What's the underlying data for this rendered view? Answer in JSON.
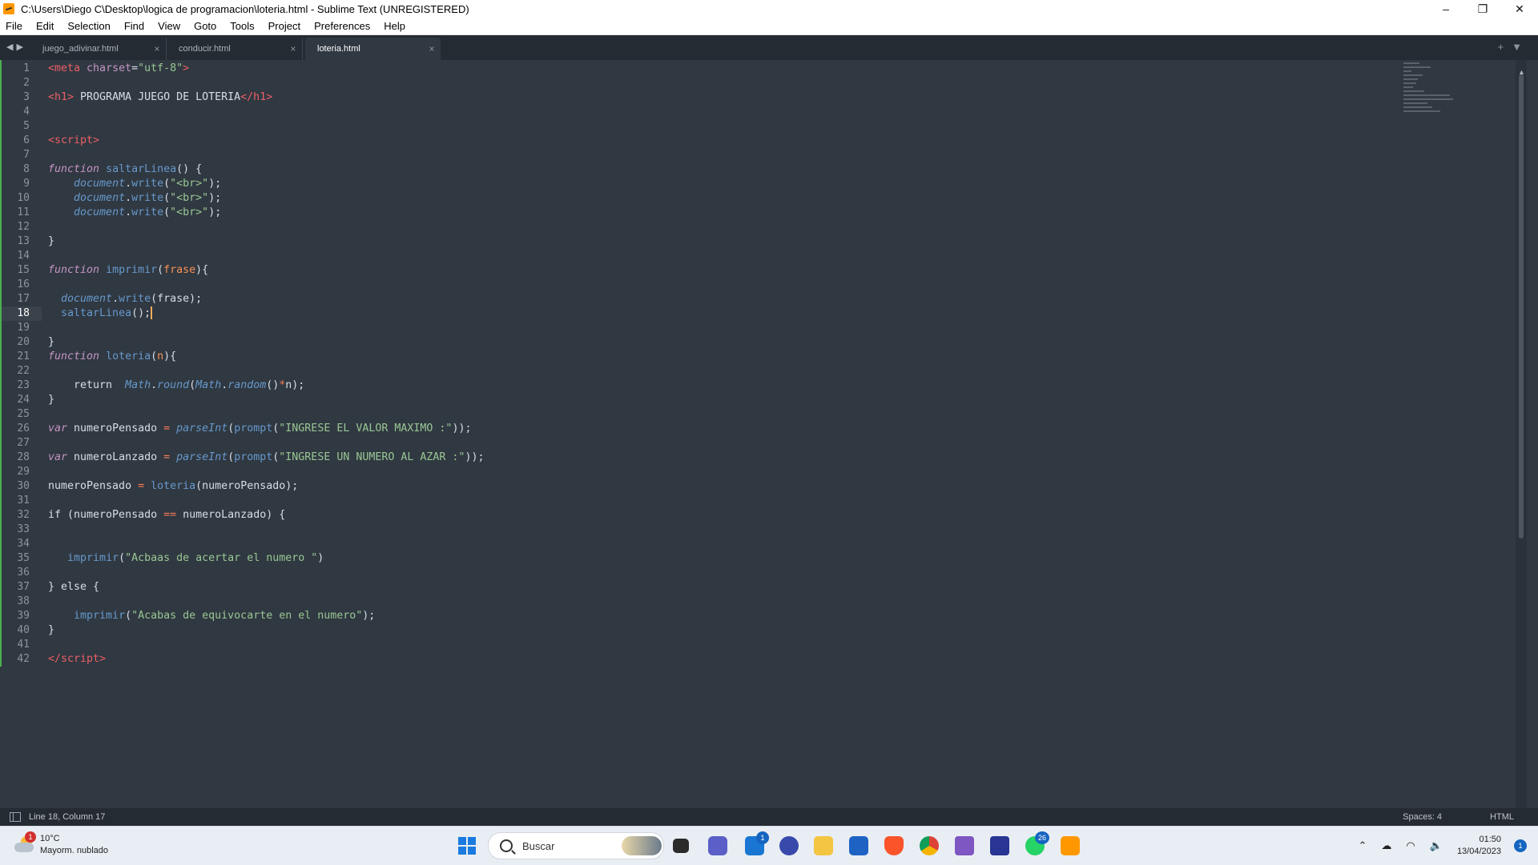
{
  "window": {
    "title": "C:\\Users\\Diego C\\Desktop\\logica de programacion\\loteria.html - Sublime Text (UNREGISTERED)",
    "minimize": "–",
    "restore": "❐",
    "close": "✕"
  },
  "menu": [
    "File",
    "Edit",
    "Selection",
    "Find",
    "View",
    "Goto",
    "Tools",
    "Project",
    "Preferences",
    "Help"
  ],
  "tabs": [
    {
      "label": "juego_adivinar.html",
      "close": "×"
    },
    {
      "label": "conducir.html",
      "close": "×"
    },
    {
      "label": "loteria.html",
      "close": "×"
    }
  ],
  "editor": {
    "current_line": 18,
    "line_numbers": [
      "1",
      "2",
      "3",
      "4",
      "5",
      "6",
      "7",
      "8",
      "9",
      "10",
      "11",
      "12",
      "13",
      "14",
      "15",
      "16",
      "17",
      "18",
      "19",
      "20",
      "21",
      "22",
      "23",
      "24",
      "25",
      "26",
      "27",
      "28",
      "29",
      "30",
      "31",
      "32",
      "33",
      "34",
      "35",
      "36",
      "37",
      "38",
      "39",
      "40",
      "41",
      "42"
    ]
  },
  "status": {
    "position": "Line 18, Column 17",
    "indent": "Spaces: 4",
    "syntax": "HTML"
  },
  "taskbar": {
    "weather_temp": "10°C",
    "weather_desc": "Mayorm. nublado",
    "weather_badge": "1",
    "search_placeholder": "Buscar",
    "mail_badge": "1",
    "whatsapp_badge": "26",
    "time": "01:50",
    "date": "13/04/2023",
    "notification_count": "1"
  },
  "colors": {
    "editor_bg": "#303841",
    "tag": "#ec5f67",
    "string": "#99c794",
    "function": "#6699cc",
    "keyword": "#c594c5",
    "parameter": "#f99157",
    "caret": "#f9ae58"
  }
}
